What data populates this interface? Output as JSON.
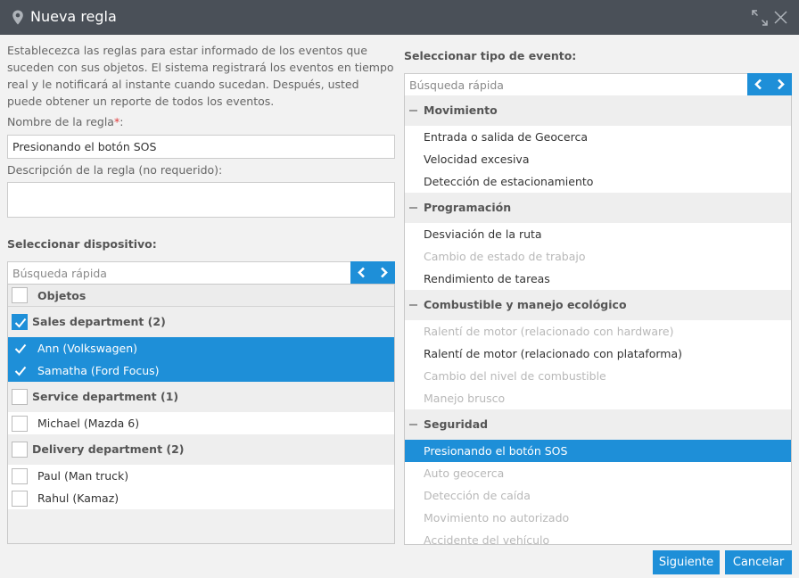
{
  "window": {
    "title": "Nueva regla",
    "pin_icon": "map-pin-icon",
    "expand_icon": "expand-icon",
    "close_icon": "close-icon"
  },
  "intro_text": "Establecezca las reglas para estar informado de los eventos que suceden con sus objetos. El sistema registrará los eventos en tiempo real y le notificará al instante cuando sucedan. Después, usted puede obtener un reporte de todos los eventos.",
  "rule_name": {
    "label": "Nombre de la regla",
    "required_mark": "*",
    "suffix": ":",
    "value": "Presionando el botón SOS"
  },
  "rule_description": {
    "label": "Descripción de la regla (no requerido):",
    "value": ""
  },
  "device": {
    "title": "Seleccionar dispositivo:",
    "search_placeholder": "Búsqueda rápida",
    "header": "Objetos",
    "rows": [
      {
        "type": "group",
        "label": "Sales department (2)",
        "checked": true
      },
      {
        "type": "item",
        "label": "Ann (Volkswagen)",
        "checked": true,
        "selected": true
      },
      {
        "type": "item",
        "label": "Samatha (Ford Focus)",
        "checked": true,
        "selected": true
      },
      {
        "type": "group",
        "label": "Service department (1)",
        "checked": false
      },
      {
        "type": "item",
        "label": "Michael (Mazda 6)",
        "checked": false,
        "selected": false
      },
      {
        "type": "group",
        "label": "Delivery department (2)",
        "checked": false
      },
      {
        "type": "item",
        "label": "Paul (Man truck)",
        "checked": false,
        "selected": false
      },
      {
        "type": "item",
        "label": "Rahul (Kamaz)",
        "checked": false,
        "selected": false
      }
    ]
  },
  "event": {
    "title": "Seleccionar tipo de evento:",
    "search_placeholder": "Búsqueda rápida",
    "rows": [
      {
        "type": "category",
        "label": "Movimiento"
      },
      {
        "type": "item",
        "label": "Entrada o salida de Geocerca",
        "enabled": true,
        "selected": false
      },
      {
        "type": "item",
        "label": "Velocidad excesiva",
        "enabled": true,
        "selected": false
      },
      {
        "type": "item",
        "label": "Detección de estacionamiento",
        "enabled": true,
        "selected": false
      },
      {
        "type": "category",
        "label": "Programación"
      },
      {
        "type": "item",
        "label": "Desviación de la ruta",
        "enabled": true,
        "selected": false
      },
      {
        "type": "item",
        "label": "Cambio de estado de trabajo",
        "enabled": false,
        "selected": false
      },
      {
        "type": "item",
        "label": "Rendimiento de tareas",
        "enabled": true,
        "selected": false
      },
      {
        "type": "category",
        "label": "Combustible y manejo ecológico"
      },
      {
        "type": "item",
        "label": "Ralentí de motor (relacionado con hardware)",
        "enabled": false,
        "selected": false
      },
      {
        "type": "item",
        "label": "Ralentí de motor (relacionado con plataforma)",
        "enabled": true,
        "selected": false
      },
      {
        "type": "item",
        "label": "Cambio del nivel de combustible",
        "enabled": false,
        "selected": false
      },
      {
        "type": "item",
        "label": "Manejo brusco",
        "enabled": false,
        "selected": false
      },
      {
        "type": "category",
        "label": "Seguridad"
      },
      {
        "type": "item",
        "label": "Presionando el botón SOS",
        "enabled": true,
        "selected": true
      },
      {
        "type": "item",
        "label": "Auto geocerca",
        "enabled": false,
        "selected": false
      },
      {
        "type": "item",
        "label": "Detección de caída",
        "enabled": false,
        "selected": false
      },
      {
        "type": "item",
        "label": "Movimiento no autorizado",
        "enabled": false,
        "selected": false
      },
      {
        "type": "item",
        "label": "Accidente del vehículo",
        "enabled": false,
        "selected": false
      }
    ]
  },
  "nav_icons": {
    "prev": "chevron-left-icon",
    "next": "chevron-right-icon"
  },
  "buttons": {
    "next": "Siguiente",
    "cancel": "Cancelar"
  },
  "colors": {
    "accent": "#1e8fd8",
    "titlebar": "#4a5058",
    "required": "#e03c3c",
    "disabled_text": "#b8b8b8"
  }
}
